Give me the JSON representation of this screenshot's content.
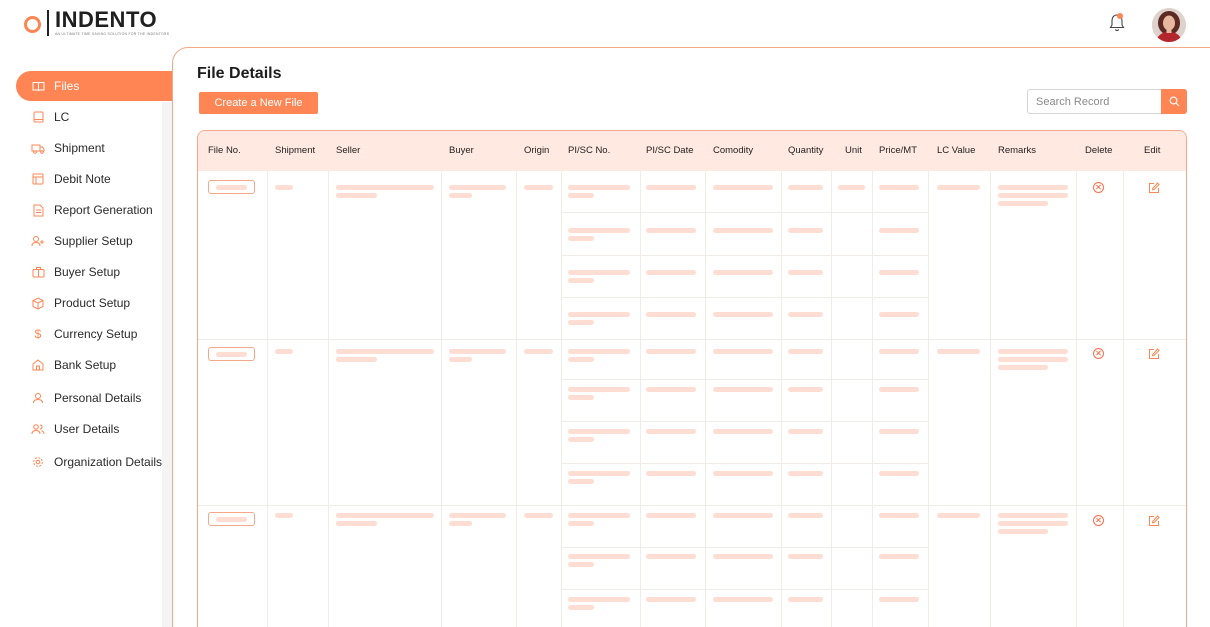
{
  "brand": {
    "name": "INDENTO",
    "tagline": "AN ULTIMATE TIME SAVING SOLUTION FOR THE INDENTORS"
  },
  "sidebar": {
    "items": [
      {
        "label": "Files",
        "icon": "book-icon",
        "active": true
      },
      {
        "label": "LC",
        "icon": "document-icon"
      },
      {
        "label": "Shipment",
        "icon": "truck-icon"
      },
      {
        "label": "Debit Note",
        "icon": "receipt-icon"
      },
      {
        "label": "Report Generation",
        "icon": "report-icon"
      },
      {
        "label": "Supplier Setup",
        "icon": "user-plus-icon"
      },
      {
        "label": "Buyer Setup",
        "icon": "briefcase-icon"
      },
      {
        "label": "Product Setup",
        "icon": "box-icon"
      },
      {
        "label": "Currency Setup",
        "icon": "dollar-icon"
      },
      {
        "label": "Bank Setup",
        "icon": "bank-icon"
      },
      {
        "label": "Personal Details",
        "icon": "user-icon"
      },
      {
        "label": "User Details",
        "icon": "users-icon"
      },
      {
        "label": "Organization Details",
        "icon": "gear-icon"
      }
    ]
  },
  "main": {
    "title": "File Details",
    "create_button": "Create a New File",
    "search_placeholder": "Search Record"
  },
  "table": {
    "columns": [
      "File No.",
      "Shipment",
      "Seller",
      "Buyer",
      "Origin",
      "PI/SC No.",
      "PI/SC Date",
      "Comodity",
      "Quantity",
      "Unit",
      "Price/MT",
      "LC Value",
      "Remarks",
      "Delete",
      "Edit"
    ]
  },
  "colors": {
    "accent": "#ff8554",
    "header_bg": "#ffe9e1",
    "placeholder": "#ffddd2",
    "delete": "#ff6b4a"
  }
}
